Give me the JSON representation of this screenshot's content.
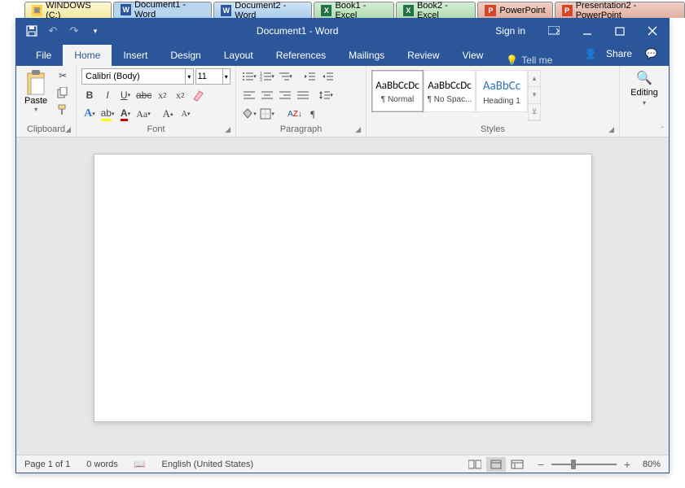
{
  "tabs": [
    {
      "label": "WINDOWS (C:)",
      "type": "folder"
    },
    {
      "label": "Document1 - Word",
      "type": "word",
      "selected": true
    },
    {
      "label": "Document2 - Word",
      "type": "word"
    },
    {
      "label": "Book1 - Excel",
      "type": "excel"
    },
    {
      "label": "Book2 - Excel",
      "type": "excel"
    },
    {
      "label": "PowerPoint",
      "type": "ppt"
    },
    {
      "label": "Presentation2 - PowerPoint",
      "type": "ppt"
    }
  ],
  "title": "Document1  -  Word",
  "signin": "Sign in",
  "ribbon_tabs": {
    "file": "File",
    "home": "Home",
    "insert": "Insert",
    "design": "Design",
    "layout": "Layout",
    "references": "References",
    "mailings": "Mailings",
    "review": "Review",
    "view": "View",
    "tellme": "Tell me",
    "share": "Share"
  },
  "clipboard": {
    "paste": "Paste",
    "label": "Clipboard"
  },
  "font": {
    "name": "Calibri (Body)",
    "size": "11",
    "label": "Font"
  },
  "paragraph": {
    "label": "Paragraph"
  },
  "styles": {
    "label": "Styles",
    "items": [
      {
        "sample": "AaBbCcDc",
        "name": "¶ Normal",
        "color": "#000",
        "selected": true
      },
      {
        "sample": "AaBbCcDc",
        "name": "¶ No Spac...",
        "color": "#000"
      },
      {
        "sample": "AaBbCc",
        "name": "Heading 1",
        "color": "#2e74b5"
      }
    ]
  },
  "editing": {
    "label": "Editing"
  },
  "status": {
    "page": "Page 1 of 1",
    "words": "0 words",
    "lang": "English (United States)",
    "zoom": "80%"
  }
}
